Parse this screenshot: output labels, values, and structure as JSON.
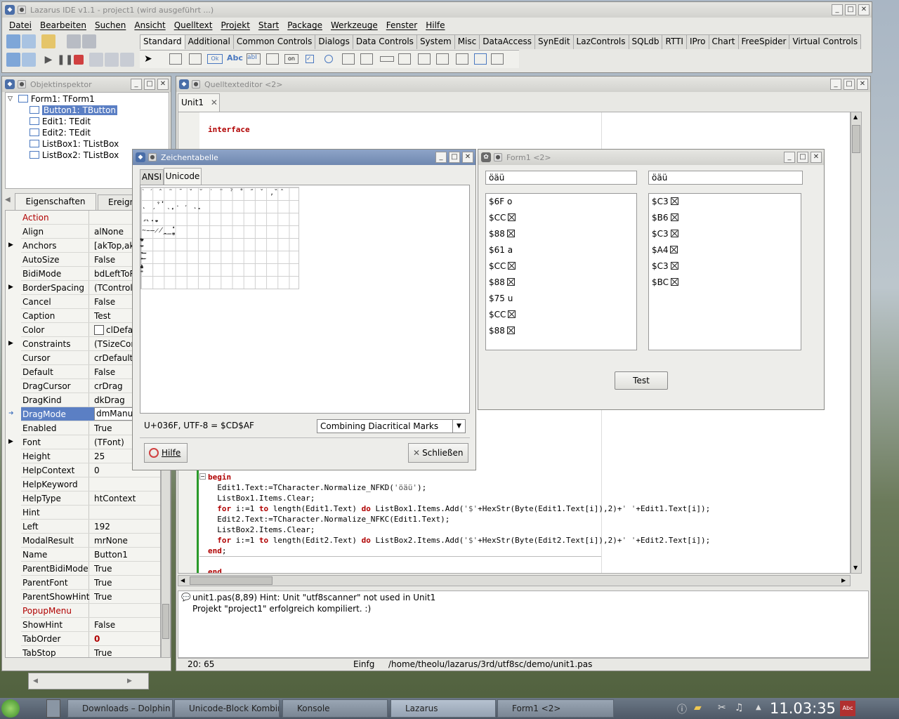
{
  "ide": {
    "title": "Lazarus IDE v1.1 - project1 (wird ausgeführt ...)",
    "menu": [
      "Datei",
      "Bearbeiten",
      "Suchen",
      "Ansicht",
      "Quelltext",
      "Projekt",
      "Start",
      "Package",
      "Werkzeuge",
      "Fenster",
      "Hilfe"
    ],
    "palette_tabs": [
      "Standard",
      "Additional",
      "Common Controls",
      "Dialogs",
      "Data Controls",
      "System",
      "Misc",
      "DataAccess",
      "SynEdit",
      "LazControls",
      "SQLdb",
      "RTTI",
      "IPro",
      "Chart",
      "FreeSpider",
      "Virtual Controls"
    ]
  },
  "inspector": {
    "title": "Objektinspektor",
    "tree": [
      {
        "label": "Form1: TForm1"
      },
      {
        "label": "Button1: TButton"
      },
      {
        "label": "Edit1: TEdit"
      },
      {
        "label": "Edit2: TEdit"
      },
      {
        "label": "ListBox1: TListBox"
      },
      {
        "label": "ListBox2: TListBox"
      }
    ],
    "tabs": [
      "Eigenschaften",
      "Ereign"
    ],
    "properties": [
      {
        "name": "Action",
        "value": ""
      },
      {
        "name": "Align",
        "value": "alNone"
      },
      {
        "name": "Anchors",
        "value": "[akTop,akL"
      },
      {
        "name": "AutoSize",
        "value": "False"
      },
      {
        "name": "BidiMode",
        "value": "bdLeftToRi"
      },
      {
        "name": "BorderSpacing",
        "value": "(TControlB"
      },
      {
        "name": "Cancel",
        "value": "False"
      },
      {
        "name": "Caption",
        "value": "Test"
      },
      {
        "name": "Color",
        "value": "clDefau"
      },
      {
        "name": "Constraints",
        "value": "(TSizeCons"
      },
      {
        "name": "Cursor",
        "value": "crDefault"
      },
      {
        "name": "Default",
        "value": "False"
      },
      {
        "name": "DragCursor",
        "value": "crDrag"
      },
      {
        "name": "DragKind",
        "value": "dkDrag"
      },
      {
        "name": "DragMode",
        "value": "dmManual"
      },
      {
        "name": "Enabled",
        "value": "True"
      },
      {
        "name": "Font",
        "value": "(TFont)"
      },
      {
        "name": "Height",
        "value": "25"
      },
      {
        "name": "HelpContext",
        "value": "0"
      },
      {
        "name": "HelpKeyword",
        "value": ""
      },
      {
        "name": "HelpType",
        "value": "htContext"
      },
      {
        "name": "Hint",
        "value": ""
      },
      {
        "name": "Left",
        "value": "192"
      },
      {
        "name": "ModalResult",
        "value": "mrNone"
      },
      {
        "name": "Name",
        "value": "Button1"
      },
      {
        "name": "ParentBidiMode",
        "value": "True"
      },
      {
        "name": "ParentFont",
        "value": "True"
      },
      {
        "name": "ParentShowHint",
        "value": "True"
      },
      {
        "name": "PopupMenu",
        "value": ""
      },
      {
        "name": "ShowHint",
        "value": "False"
      },
      {
        "name": "TabOrder",
        "value": "0"
      },
      {
        "name": "TabStop",
        "value": "True"
      }
    ]
  },
  "editor": {
    "title": "Quelltexteditor <2>",
    "tab": "Unit1",
    "line_interface": "interface",
    "messages": [
      "unit1.pas(8,89) Hint: Unit \"utf8scanner\" not used in Unit1",
      "Projekt \"project1\" erfolgreich kompiliert. :)"
    ],
    "status": {
      "pos": "20: 65",
      "mode": "Einfg",
      "file": "/home/theolu/lazarus/3rd/utf8sc/demo/unit1.pas"
    }
  },
  "charmap": {
    "title": "Zeichentabelle",
    "tabs": [
      "ANSI",
      "Unicode"
    ],
    "info": "U+036F, UTF-8 = $CD$AF",
    "block": "Combining Diacritical Marks",
    "help": "Hilfe",
    "close": "Schließen"
  },
  "form1": {
    "title": "Form1 <2>",
    "edit1": "öäü",
    "edit2": "öäü",
    "list1": [
      {
        "text": "$6F o",
        "box": false
      },
      {
        "text": "$CC",
        "box": true
      },
      {
        "text": "$88",
        "box": true
      },
      {
        "text": "$61 a",
        "box": false
      },
      {
        "text": "$CC",
        "box": true
      },
      {
        "text": "$88",
        "box": true
      },
      {
        "text": "$75 u",
        "box": false
      },
      {
        "text": "$CC",
        "box": true
      },
      {
        "text": "$88",
        "box": true
      }
    ],
    "list2": [
      {
        "text": "$C3",
        "box": true
      },
      {
        "text": "$B6",
        "box": true
      },
      {
        "text": "$C3",
        "box": true
      },
      {
        "text": "$A4",
        "box": true
      },
      {
        "text": "$C3",
        "box": true
      },
      {
        "text": "$BC",
        "box": true
      }
    ],
    "button": "Test"
  },
  "taskbar": {
    "items": [
      "Downloads – Dolphin",
      "Unicode-Block Kombini",
      "Konsole",
      "Lazarus",
      "Form1 <2>"
    ],
    "clock": "11.03:35"
  },
  "colors": {
    "keyword": "#b00000",
    "selection": "#5b7fc4",
    "active_title": "#7a92ba"
  }
}
